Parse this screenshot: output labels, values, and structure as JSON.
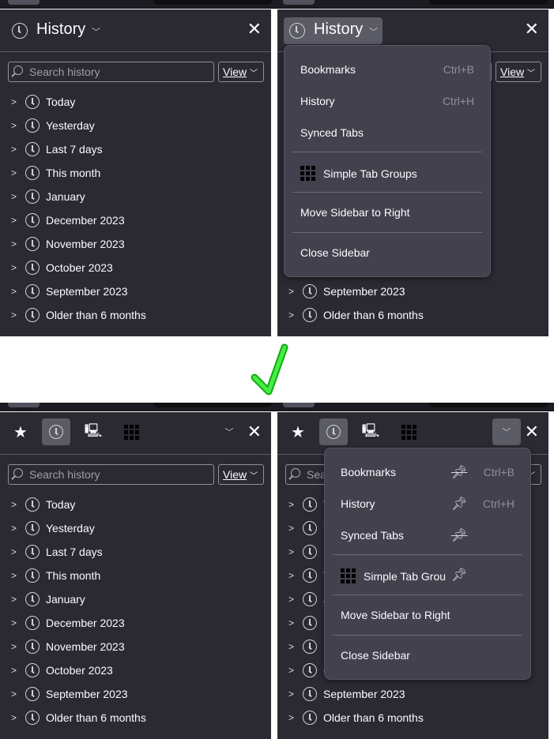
{
  "sidebar_title": "History",
  "search_placeholder": "Search history",
  "view_label": "View",
  "close_glyph": "✕",
  "history_items": [
    "Today",
    "Yesterday",
    "Last 7 days",
    "This month",
    "January",
    "December 2023",
    "November 2023",
    "October 2023",
    "September 2023",
    "Older than 6 months"
  ],
  "menu": {
    "items": [
      {
        "label": "Bookmarks",
        "shortcut": "Ctrl+B",
        "pinned": false
      },
      {
        "label": "History",
        "shortcut": "Ctrl+H",
        "pinned": true
      },
      {
        "label": "Synced Tabs",
        "shortcut": "",
        "pinned": false
      },
      {
        "label": "Simple Tab Groups",
        "shortcut": "",
        "pinned": true
      },
      {
        "label": "Move Sidebar to Right"
      },
      {
        "label": "Close Sidebar"
      }
    ],
    "truncated_label": "Simple Tab Grou"
  },
  "toolbar_icons": [
    "star-icon",
    "clock-icon",
    "synced-tabs-icon",
    "grid-icon"
  ],
  "colors": {
    "panel": "#2b2a33",
    "menu": "#42414d",
    "arrow": "#22cc22",
    "active": "#5b5b66"
  }
}
